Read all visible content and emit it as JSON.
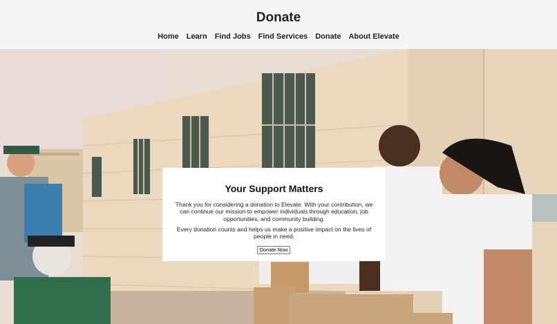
{
  "header": {
    "title": "Donate",
    "nav": [
      {
        "label": "Home"
      },
      {
        "label": "Learn"
      },
      {
        "label": "Find Jobs"
      },
      {
        "label": "Find Services"
      },
      {
        "label": "Donate"
      },
      {
        "label": "About Elevate"
      }
    ]
  },
  "hero": {
    "image_icon": "volunteers-photo"
  },
  "card": {
    "title": "Your Support Matters",
    "paragraph1": "Thank you for considering a donation to Elevate. With your contribution, we can continue our mission to empower individuals through education, job opportunities, and community building.",
    "paragraph2": "Every donation counts and helps us make a positive impact on the lives of people in need.",
    "button_label": "Donate Now"
  },
  "colors": {
    "header_bg": "#f5f5f5",
    "card_bg": "#ffffff",
    "text": "#222222"
  }
}
